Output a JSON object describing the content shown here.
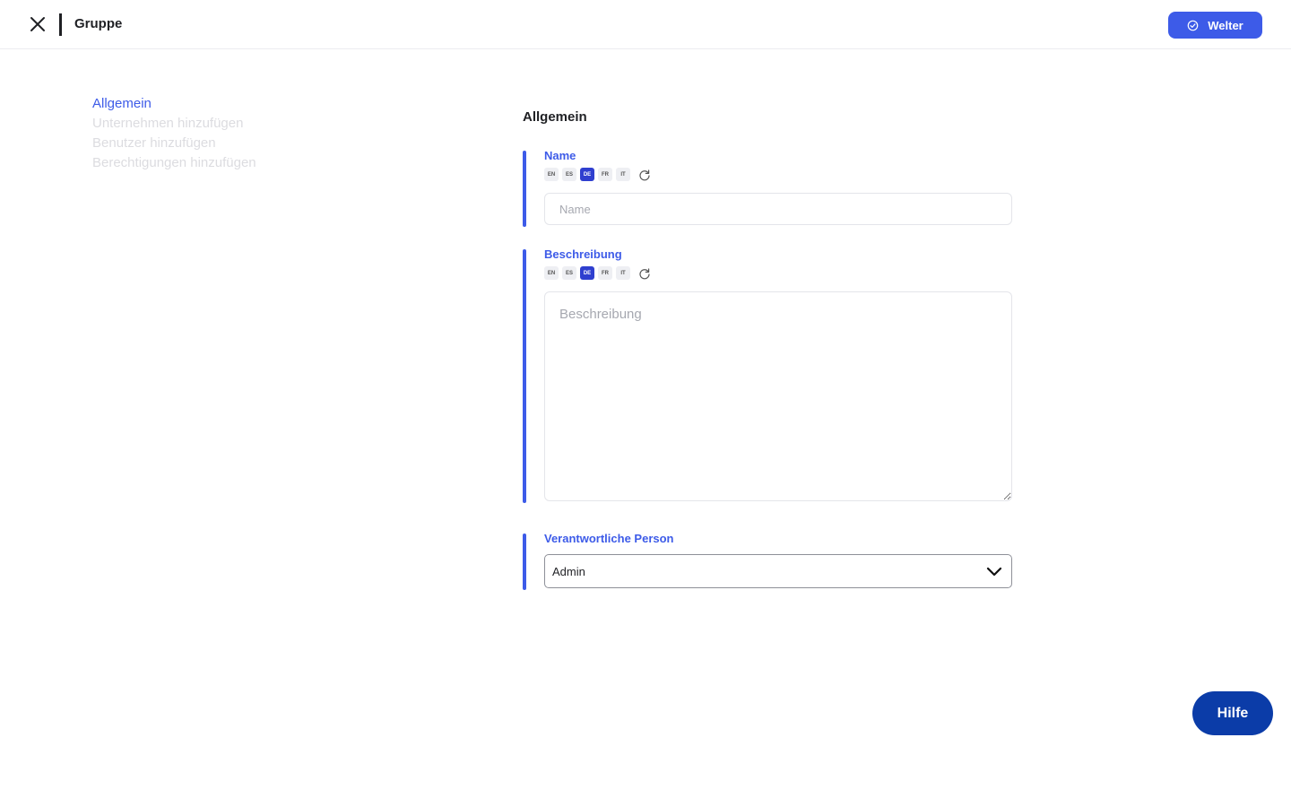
{
  "header": {
    "close_icon": "close-icon",
    "title": "Gruppe",
    "next_label": "Welter",
    "next_icon": "check-circle-icon"
  },
  "steps": [
    {
      "label": "Allgemein",
      "active": true
    },
    {
      "label": "Unternehmen hinzufügen",
      "active": false
    },
    {
      "label": "Benutzer hinzufügen",
      "active": false
    },
    {
      "label": "Berechtigungen hinzufügen",
      "active": false
    }
  ],
  "section": {
    "title": "Allgemein"
  },
  "languages": [
    "EN",
    "ES",
    "DE",
    "FR",
    "IT"
  ],
  "active_language": "DE",
  "name_field": {
    "label": "Name",
    "placeholder": "Name",
    "value": ""
  },
  "description_field": {
    "label": "Beschreibung",
    "placeholder": "Beschreibung",
    "value": ""
  },
  "responsible_field": {
    "label": "Verantwortliche Person",
    "value": "Admin"
  },
  "help": {
    "label": "Hilfe"
  },
  "colors": {
    "accent": "#3d5be8",
    "help": "#0b3ca8",
    "inactive_step": "#dcdce0"
  }
}
